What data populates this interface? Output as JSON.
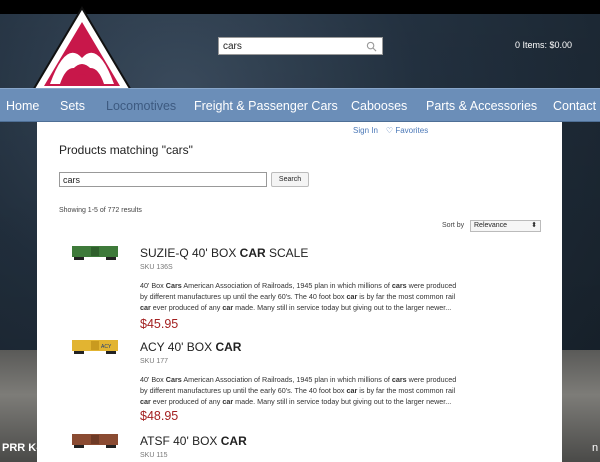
{
  "header": {
    "search_value": "cars",
    "cart_text": "0 Items: $0.00"
  },
  "nav": {
    "items": [
      "Home",
      "Sets",
      "Locomotives",
      "Freight & Passenger Cars",
      "Cabooses",
      "Parts & Accessories",
      "Contact"
    ]
  },
  "background_caption": {
    "left": "PRR K-",
    "right": "n"
  },
  "account": {
    "sign_in": "Sign In",
    "favorites": "Favorites"
  },
  "results": {
    "title": "Products matching \"cars\"",
    "search_value": "cars",
    "search_button": "Search",
    "showing": "Showing 1-5 of 772 results",
    "sort_label": "Sort by",
    "sort_value": "Relevance"
  },
  "products": [
    {
      "name_prefix": "SUZIE-Q 40' BOX ",
      "name_bold": "CAR",
      "name_suffix": " SCALE",
      "sku": "SKU 136S",
      "price": "$45.95"
    },
    {
      "name_prefix": "ACY 40' BOX ",
      "name_bold": "CAR",
      "name_suffix": "",
      "sku": "SKU 177",
      "price": "$48.95"
    },
    {
      "name_prefix": "ATSF 40' BOX ",
      "name_bold": "CAR",
      "name_suffix": "",
      "sku": "SKU 115",
      "price": ""
    }
  ],
  "description": {
    "l1a": "40' Box ",
    "l1b": "Cars",
    "l1c": " American Association of Railroads, 1945 plan in which millions of ",
    "l1d": "cars",
    "l1e": " were produced",
    "l2a": "by different manufactures up until the early 60's. The 40 foot box ",
    "l2b": "car",
    "l2c": " is by far the most common rail",
    "l3a": "car",
    "l3b": " ever produced of any ",
    "l3c": "car",
    "l3d": " made. Many still in service today but giving out to the larger newer..."
  },
  "colors": {
    "nav_bg": "#6b8eb8",
    "price": "#a32020",
    "link": "#4b78b7",
    "logo_red": "#c8174a"
  }
}
